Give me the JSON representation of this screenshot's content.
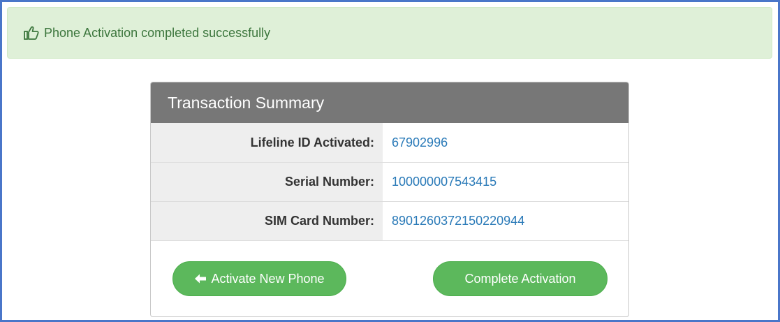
{
  "alert": {
    "icon": "thumbs-up-icon",
    "message": "Phone Activation completed successfully"
  },
  "summary": {
    "title": "Transaction Summary",
    "rows": [
      {
        "label": "Lifeline ID Activated:",
        "value": "67902996"
      },
      {
        "label": "Serial Number:",
        "value": "100000007543415"
      },
      {
        "label": "SIM Card Number:",
        "value": "8901260372150220944"
      }
    ]
  },
  "buttons": {
    "activate_new": {
      "label": "Activate New Phone",
      "icon": "arrow-left-icon"
    },
    "complete": {
      "label": "Complete Activation"
    }
  },
  "colors": {
    "success_bg": "#dff0d8",
    "success_text": "#3c763d",
    "panel_header": "#777777",
    "button_green": "#5cb85c",
    "link_value": "#2a7ab8",
    "frame_border": "#4a76c9"
  }
}
